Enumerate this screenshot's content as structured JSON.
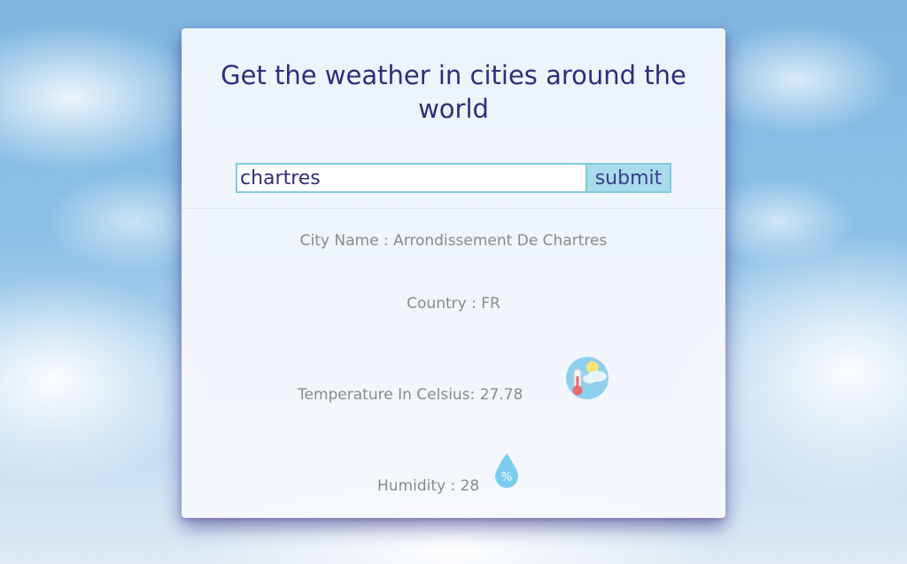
{
  "header": {
    "title": "Get the weather in cities around the world"
  },
  "search": {
    "value": "chartres",
    "submit_label": "submit"
  },
  "weather": {
    "city_line": "City Name : Arrondissement De Chartres",
    "country_line": "Country : FR",
    "temperature_line": "Temperature In Celsius: 27.78",
    "humidity_line": "Humidity : 28"
  },
  "icons": {
    "temperature": "thermometer-sun-icon",
    "humidity": "water-drop-percent-icon",
    "humidity_symbol": "%"
  },
  "colors": {
    "title": "#2e2f7a",
    "accent_border": "#7ecbdc",
    "button_bg": "#a8dcea",
    "info_text": "#8a8a8a"
  }
}
